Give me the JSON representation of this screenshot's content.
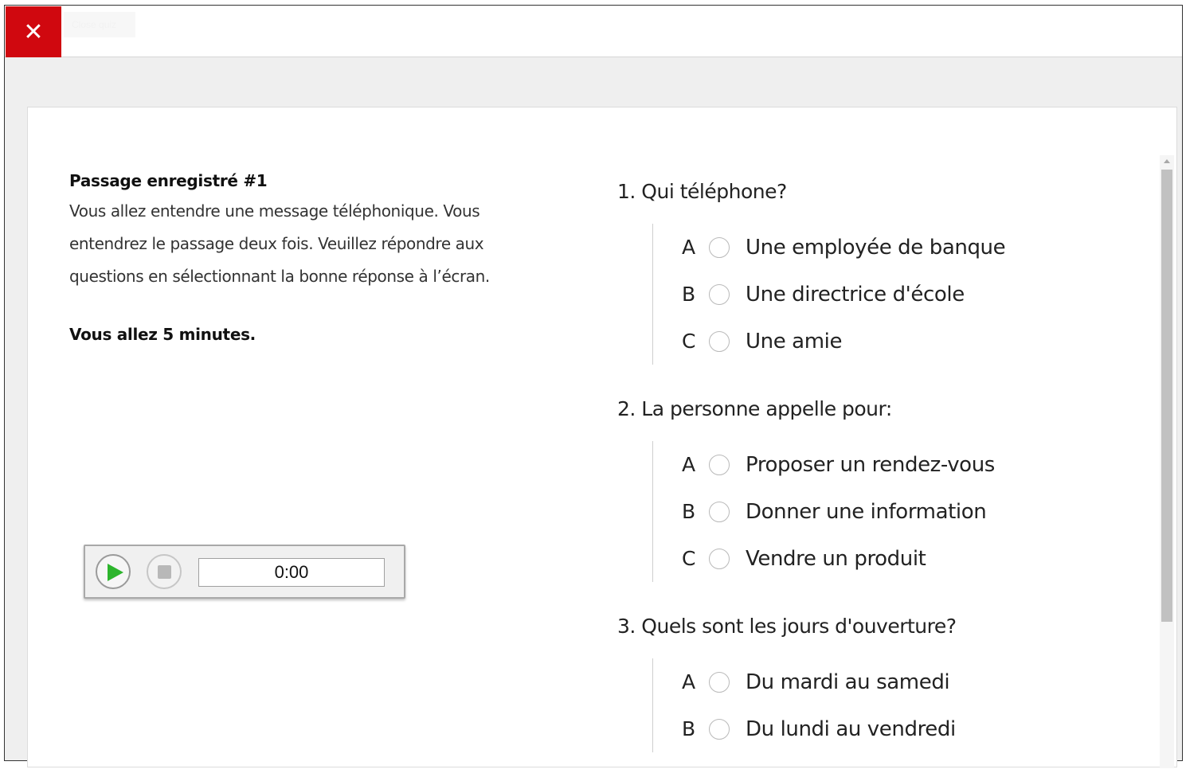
{
  "topbar": {
    "close_icon": "close-icon",
    "close_label": "Close quiz"
  },
  "passage": {
    "title": "Passage enregistré #1",
    "body": "Vous allez entendre une message téléphonique. Vous entendrez le passage deux fois. Veuillez répondre aux questions en sélectionnant la bonne réponse à l’écran.",
    "time_note": "Vous allez 5 minutes."
  },
  "player": {
    "time": "0:00",
    "play_icon": "play-icon",
    "stop_icon": "stop-icon"
  },
  "questions": [
    {
      "title": "1. Qui téléphone?",
      "options": [
        {
          "letter": "A",
          "text": "Une employée de banque"
        },
        {
          "letter": "B",
          "text": "Une directrice d'école"
        },
        {
          "letter": "C",
          "text": "Une amie"
        }
      ]
    },
    {
      "title": "2. La personne appelle pour:",
      "options": [
        {
          "letter": "A",
          "text": "Proposer un rendez-vous"
        },
        {
          "letter": "B",
          "text": "Donner une information"
        },
        {
          "letter": "C",
          "text": "Vendre un produit"
        }
      ]
    },
    {
      "title": "3. Quels sont les jours d'ouverture?",
      "options": [
        {
          "letter": "A",
          "text": "Du mardi au samedi"
        },
        {
          "letter": "B",
          "text": "Du lundi au vendredi"
        }
      ]
    }
  ],
  "colors": {
    "accent_red": "#d0080f",
    "play_green": "#2db52d"
  }
}
